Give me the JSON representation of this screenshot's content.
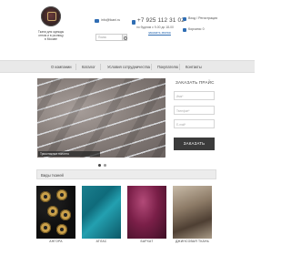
{
  "header": {
    "tagline": [
      "Ткани для одежды",
      "оптом и в розницу",
      "в Москве"
    ],
    "email": "info@tkani.ru",
    "search_placeholder": "Поиск",
    "phone": "+7 925 112 31 02",
    "hours": "по будням с 9-00 до 18-00",
    "callback": "заказать звонок",
    "login": "Вход / Регистрация",
    "cart": "Корзина: 0"
  },
  "nav": [
    "О компании",
    "Каталог",
    "Условия сотрудничества",
    "Покупателю",
    "Контакты"
  ],
  "slider": {
    "caption": "Трикотажное полотно",
    "slide_count": 2,
    "active_slide": 1
  },
  "order_form": {
    "title": "ЗАКАЗАТЬ ПРАЙС",
    "fields": [
      "Имя*",
      "Телефон*",
      "E-mail*"
    ],
    "submit": "ЗАКАЗАТЬ"
  },
  "fabrics": {
    "title": "Виды тканей",
    "items": [
      "Ангора",
      "Атлас",
      "Бархат",
      "Джинсовая ткань"
    ]
  },
  "colors": {
    "nav_bg": "#e9e9e9",
    "button": "#3b3b3b",
    "accent": "#2f6db3"
  }
}
